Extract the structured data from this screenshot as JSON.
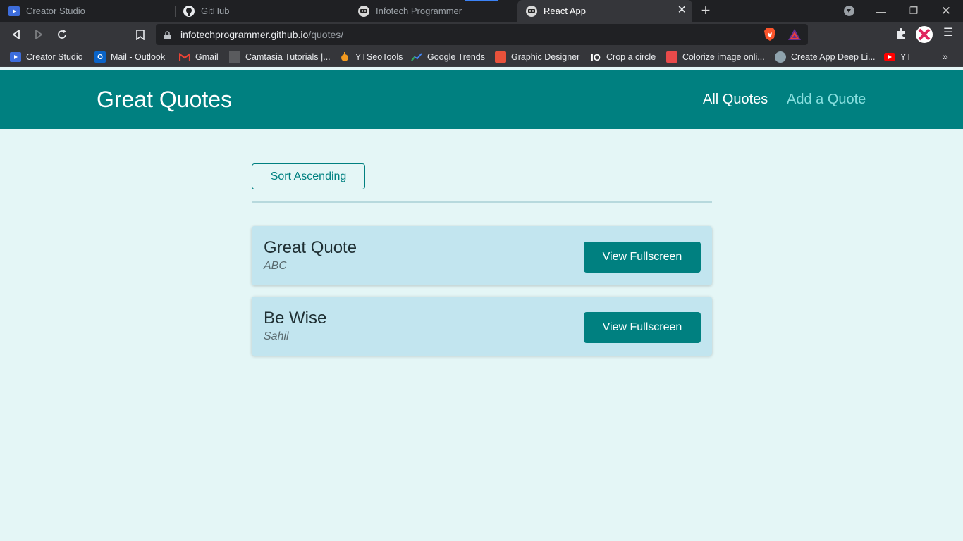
{
  "browser": {
    "tabs": [
      {
        "title": "Creator Studio",
        "icon": "creator-studio-icon"
      },
      {
        "title": "GitHub",
        "icon": "github-icon"
      },
      {
        "title": "Infotech Programmer",
        "icon": "infotech-icon"
      },
      {
        "title": "React App",
        "icon": "infotech-icon",
        "active": true
      }
    ],
    "url_host": "infotechprogrammer.github.io",
    "url_path": "/quotes/",
    "bookmarks": [
      {
        "label": "Creator Studio",
        "icon": "creator-studio-icon"
      },
      {
        "label": "Mail - Outlook",
        "icon": "outlook-icon"
      },
      {
        "label": "Gmail",
        "icon": "gmail-icon"
      },
      {
        "label": "Camtasia Tutorials |...",
        "icon": "camtasia-icon"
      },
      {
        "label": "YTSeoTools",
        "icon": "ytseotools-icon"
      },
      {
        "label": "Google Trends",
        "icon": "google-trends-icon"
      },
      {
        "label": "Graphic Designer",
        "icon": "graphic-designer-icon"
      },
      {
        "label": "Crop a circle",
        "icon": "crop-circle-icon"
      },
      {
        "label": "Colorize image onli...",
        "icon": "colorize-icon"
      },
      {
        "label": "Create App Deep Li...",
        "icon": "deep-link-icon"
      },
      {
        "label": "YT",
        "icon": "youtube-icon"
      }
    ],
    "bookmarks_more": "»"
  },
  "app": {
    "title": "Great Quotes",
    "nav": {
      "all_quotes": "All Quotes",
      "add_quote": "Add a Quote"
    },
    "sort_label": "Sort Ascending",
    "quotes": [
      {
        "text": "Great Quote",
        "author": "ABC",
        "button": "View Fullscreen"
      },
      {
        "text": "Be Wise",
        "author": "Sahil",
        "button": "View Fullscreen"
      }
    ]
  },
  "colors": {
    "primary": "#008080",
    "page_bg": "#e4f6f6",
    "card_bg": "#c2e5ef",
    "nav_inactive": "#88dfdf"
  }
}
